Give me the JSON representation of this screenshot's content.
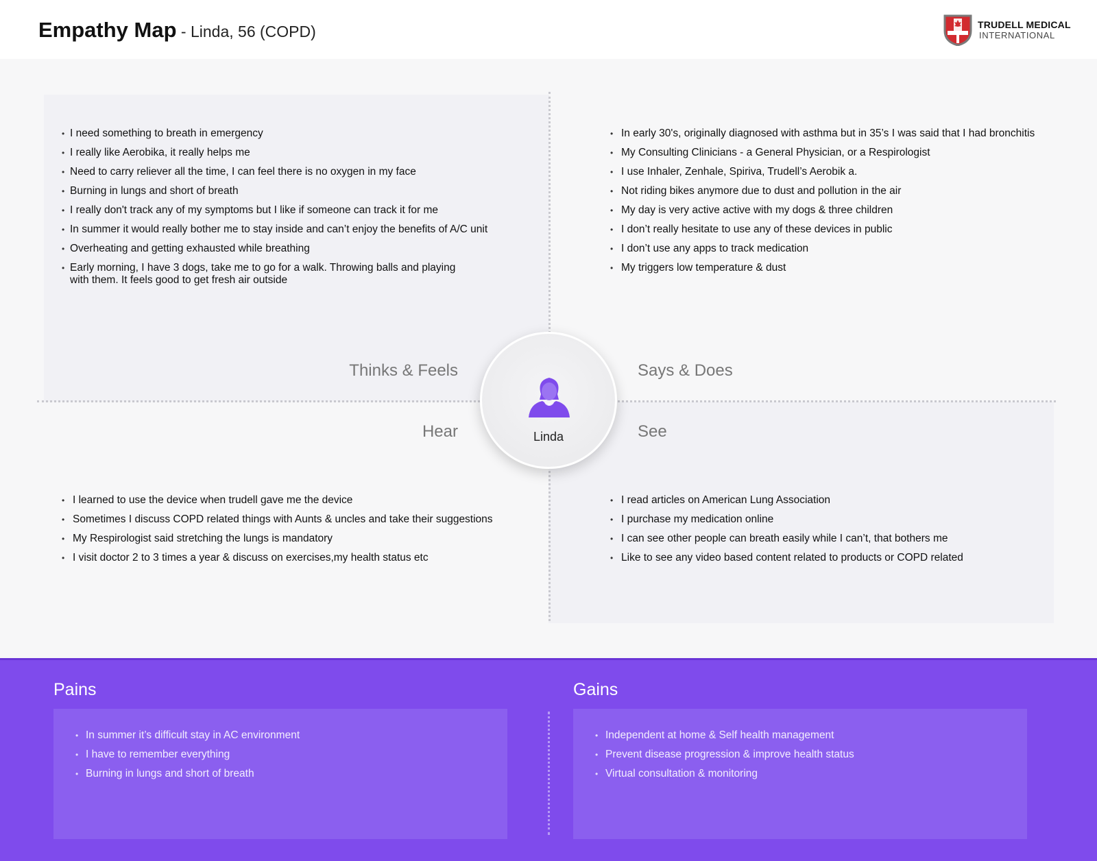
{
  "header": {
    "title": "Empathy Map",
    "subtitle": " - Linda, 56 (COPD)",
    "logo_name": "TRUDELL MEDICAL",
    "logo_sub": "INTERNATIONAL"
  },
  "persona": {
    "name": "Linda",
    "icon": "user-female-icon",
    "color": "#7f4bec"
  },
  "quadrants": {
    "thinks_feels": {
      "label": "Thinks & Feels",
      "items": [
        "I need something to breath in emergency",
        "I really like Aerobika, it really helps me",
        "Need to carry reliever all the time, I can feel there is no oxygen in my face",
        "Burning in lungs and short of breath",
        "I really don't track any of my symptoms but I like if someone can track it for me",
        "In summer it would really bother me to stay inside and can’t enjoy the benefits of A/C unit",
        "Overheating and getting exhausted while breathing",
        "Early morning, I have 3 dogs, take me to go for a walk. Throwing balls and playing with them. It feels good to get fresh air outside"
      ]
    },
    "says_does": {
      "label": "Says & Does",
      "items": [
        "In early 30's, originally diagnosed with asthma but in 35’s I was said that I had bronchitis",
        "My Consulting Clinicians - a General Physician, or a Respirologist",
        "I use Inhaler, Zenhale, Spiriva, Trudell’s Aerobik a.",
        "Not riding bikes anymore due to dust and pollution in the air",
        "My day is very active active with my dogs & three children",
        "I don’t really hesitate to use any of these devices in public",
        "I don’t use any apps to track medication",
        "My triggers  low temperature & dust"
      ]
    },
    "hear": {
      "label": "Hear",
      "items": [
        "I learned to use the device when trudell gave me the device",
        "Sometimes I discuss COPD related things with Aunts & uncles and take their suggestions",
        "My Respirologist said stretching the lungs is mandatory",
        "I visit doctor 2 to 3 times a year & discuss on exercises,my health status etc"
      ]
    },
    "see": {
      "label": "See",
      "items": [
        "I read articles on American Lung Association",
        "I purchase my medication online",
        "I can see other people can breath easily while I can’t, that bothers me",
        "Like to see any video based content related to products or COPD related"
      ]
    }
  },
  "pains": {
    "title": "Pains",
    "items": [
      "In summer it’s difficult stay in AC environment",
      "I have to remember everything",
      "Burning in lungs and short of breath"
    ]
  },
  "gains": {
    "title": "Gains",
    "items": [
      "Independent at home & Self health management",
      "Prevent disease progression & improve health status",
      "Virtual consultation & monitoring"
    ]
  },
  "colors": {
    "accent": "#7f4bec",
    "panel": "#f1f1f5",
    "background": "#f7f7f8"
  }
}
